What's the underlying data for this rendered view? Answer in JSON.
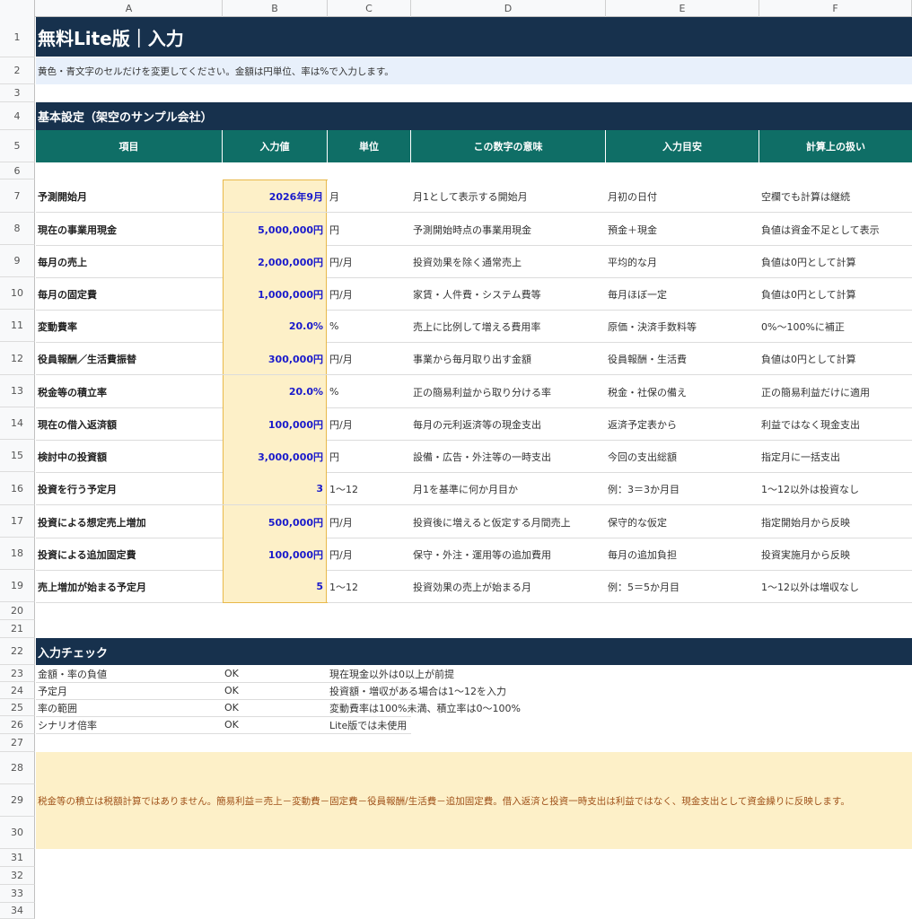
{
  "columns": [
    "A",
    "B",
    "C",
    "D",
    "E",
    "F"
  ],
  "rows": [
    "1",
    "2",
    "3",
    "4",
    "5",
    "6",
    "7",
    "8",
    "9",
    "10",
    "11",
    "12",
    "13",
    "14",
    "15",
    "16",
    "17",
    "18",
    "19",
    "20",
    "21",
    "22",
    "23",
    "24",
    "25",
    "26",
    "27",
    "28",
    "29",
    "30",
    "31",
    "32",
    "33",
    "34"
  ],
  "title": "無料Lite版｜入力",
  "note": "黄色・青文字のセルだけを変更してください。金額は円単位、率は%で入力します。",
  "section_basic": "基本設定（架空のサンプル会社）",
  "headers": [
    "項目",
    "入力値",
    "単位",
    "この数字の意味",
    "入力目安",
    "計算上の扱い"
  ],
  "items": [
    {
      "label": "予測開始月",
      "value": "2026年9月",
      "unit": "月",
      "meaning": "月1として表示する開始月",
      "guide": "月初の日付",
      "handling": "空欄でも計算は継続"
    },
    {
      "label": "現在の事業用現金",
      "value": "5,000,000円",
      "unit": "円",
      "meaning": "予測開始時点の事業用現金",
      "guide": "預金＋現金",
      "handling": "負値は資金不足として表示"
    },
    {
      "label": "毎月の売上",
      "value": "2,000,000円",
      "unit": "円/月",
      "meaning": "投資効果を除く通常売上",
      "guide": "平均的な月",
      "handling": "負値は0円として計算"
    },
    {
      "label": "毎月の固定費",
      "value": "1,000,000円",
      "unit": "円/月",
      "meaning": "家賃・人件費・システム費等",
      "guide": "毎月ほぼ一定",
      "handling": "負値は0円として計算"
    },
    {
      "label": "変動費率",
      "value": "20.0%",
      "unit": "%",
      "meaning": "売上に比例して増える費用率",
      "guide": "原価・決済手数料等",
      "handling": "0%〜100%に補正"
    },
    {
      "label": "役員報酬／生活費振替",
      "value": "300,000円",
      "unit": "円/月",
      "meaning": "事業から毎月取り出す金額",
      "guide": "役員報酬・生活費",
      "handling": "負値は0円として計算"
    },
    {
      "label": "税金等の積立率",
      "value": "20.0%",
      "unit": "%",
      "meaning": "正の簡易利益から取り分ける率",
      "guide": "税金・社保の備え",
      "handling": "正の簡易利益だけに適用"
    },
    {
      "label": "現在の借入返済額",
      "value": "100,000円",
      "unit": "円/月",
      "meaning": "毎月の元利返済等の現金支出",
      "guide": "返済予定表から",
      "handling": "利益ではなく現金支出"
    },
    {
      "label": "検討中の投資額",
      "value": "3,000,000円",
      "unit": "円",
      "meaning": "設備・広告・外注等の一時支出",
      "guide": "今回の支出総額",
      "handling": "指定月に一括支出"
    },
    {
      "label": "投資を行う予定月",
      "value": "3",
      "unit": "1〜12",
      "meaning": "月1を基準に何か月目か",
      "guide": "例：3＝3か月目",
      "handling": "1〜12以外は投資なし"
    },
    {
      "label": "投資による想定売上増加",
      "value": "500,000円",
      "unit": "円/月",
      "meaning": "投資後に増えると仮定する月間売上",
      "guide": "保守的な仮定",
      "handling": "指定開始月から反映"
    },
    {
      "label": "投資による追加固定費",
      "value": "100,000円",
      "unit": "円/月",
      "meaning": "保守・外注・運用等の追加費用",
      "guide": "毎月の追加負担",
      "handling": "投資実施月から反映"
    },
    {
      "label": "売上増加が始まる予定月",
      "value": "5",
      "unit": "1〜12",
      "meaning": "投資効果の売上が始まる月",
      "guide": "例：5＝5か月目",
      "handling": "1〜12以外は増収なし"
    }
  ],
  "section_check": "入力チェック",
  "checks": [
    {
      "label": "金額・率の負値",
      "status": "OK",
      "note": "現在現金以外は0以上が前提"
    },
    {
      "label": "予定月",
      "status": "OK",
      "note": "投資額・増収がある場合は1〜12を入力"
    },
    {
      "label": "率の範囲",
      "status": "OK",
      "note": "変動費率は100%未満、積立率は0〜100%"
    },
    {
      "label": "シナリオ倍率",
      "status": "OK",
      "note": "Lite版では未使用"
    }
  ],
  "warning": "税金等の積立は税額計算ではありません。簡易利益＝売上－変動費－固定費－役員報酬/生活費－追加固定費。借入返済と投資一時支出は利益ではなく、現金支出として資金繰りに反映します。"
}
